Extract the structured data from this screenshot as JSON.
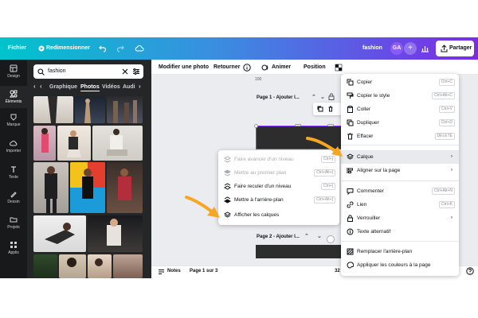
{
  "topbar": {
    "menu_file": "Fichier",
    "resize": "Redimensionner",
    "doc_title": "fashion",
    "avatar_initials": "GA",
    "share_label": "Partager",
    "gradient": [
      "#00c4cc",
      "#7d2ae8"
    ]
  },
  "rail": {
    "items": [
      {
        "label": "Design",
        "icon": "layout-icon"
      },
      {
        "label": "Éléments",
        "icon": "shapes-icon"
      },
      {
        "label": "Marque",
        "icon": "brand-icon"
      },
      {
        "label": "Importer",
        "icon": "upload-cloud-icon"
      },
      {
        "label": "Texte",
        "icon": "text-t-icon"
      },
      {
        "label": "Dessin",
        "icon": "pen-icon"
      },
      {
        "label": "Projets",
        "icon": "folder-icon"
      },
      {
        "label": "Applis",
        "icon": "grid-icon"
      }
    ]
  },
  "panel": {
    "search_value": "fashion",
    "tabs": [
      "Graphique",
      "Photos",
      "Vidéos",
      "Audi"
    ]
  },
  "toolbar": {
    "edit_photo": "Modifier une photo",
    "flip": "Retourner",
    "animate": "Animer",
    "position": "Position"
  },
  "canvas": {
    "ruler_mark": "100",
    "page1_label": "Page 1 - Ajouter l...",
    "page2_label": "Page 2 - Ajouter l..."
  },
  "footer": {
    "notes": "Notes",
    "page_counter": "Page 1 sur 3",
    "zoom": "32"
  },
  "context_menu": {
    "items": [
      {
        "label": "Copier",
        "shortcut": "Ctrl+C",
        "icon": "copy-icon"
      },
      {
        "label": "Copier le style",
        "shortcut": "Ctrl+Alt+C",
        "icon": "paint-roller-icon"
      },
      {
        "label": "Coller",
        "shortcut": "Ctrl+V",
        "icon": "clipboard-icon"
      },
      {
        "label": "Dupliquer",
        "shortcut": "Ctrl+D",
        "icon": "duplicate-icon"
      },
      {
        "label": "Effacer",
        "shortcut": "DELETE",
        "icon": "trash-icon"
      },
      {
        "label": "Calque",
        "shortcut": "",
        "icon": "layers-icon"
      },
      {
        "label": "Aligner sur la page",
        "shortcut": "",
        "icon": "align-icon"
      },
      {
        "label": "Commenter",
        "shortcut": "Ctrl+Alt+N",
        "icon": "comment-icon"
      },
      {
        "label": "Lien",
        "shortcut": "Ctrl+K",
        "icon": "link-icon"
      },
      {
        "label": "Verrouiller",
        "shortcut": "",
        "icon": "lock-icon"
      },
      {
        "label": "Texte alternatif",
        "shortcut": "",
        "icon": "alt-text-icon"
      },
      {
        "label": "Remplacer l'arrière-plan",
        "shortcut": "",
        "icon": "background-replace-icon"
      },
      {
        "label": "Appliquer les couleurs à la page",
        "shortcut": "",
        "icon": "palette-icon"
      }
    ]
  },
  "layer_submenu": {
    "items": [
      {
        "label": "Faire avancer d'un niveau",
        "shortcut": "Ctrl+]",
        "enabled": false
      },
      {
        "label": "Mettre au premier plan",
        "shortcut": "Ctrl+Alt+]",
        "enabled": false
      },
      {
        "label": "Faire reculer d'un niveau",
        "shortcut": "Ctrl+[",
        "enabled": true
      },
      {
        "label": "Mettre à l'arrière-plan",
        "shortcut": "Ctrl+Alt+[",
        "enabled": true
      },
      {
        "label": "Afficher les calques",
        "shortcut": "",
        "enabled": true
      }
    ]
  },
  "colors": {
    "highlight": "#e8eaed",
    "arrow": "#f5a623",
    "selection": "#8b3dff"
  }
}
